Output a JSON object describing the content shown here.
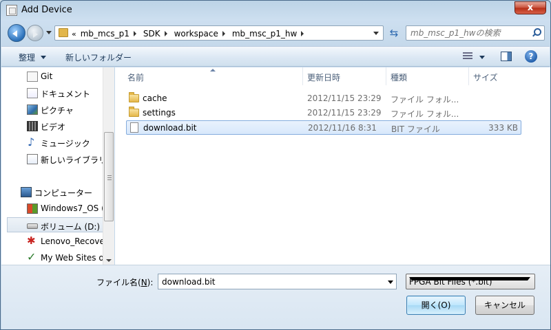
{
  "window": {
    "title": "Add Device",
    "close_label": "x"
  },
  "address": {
    "overflow": "«",
    "crumbs": [
      "mb_mcs_p1",
      "SDK",
      "workspace",
      "mb_msc_p1_hw"
    ]
  },
  "search": {
    "placeholder": "mb_msc_p1_hwの検索"
  },
  "toolbar": {
    "organize": "整理",
    "new_folder": "新しいフォルダー",
    "help": "?"
  },
  "nav": {
    "items": [
      {
        "label": "Git",
        "icon": "git-folder-icon"
      },
      {
        "label": "ドキュメント",
        "icon": "documents-icon"
      },
      {
        "label": "ピクチャ",
        "icon": "pictures-icon"
      },
      {
        "label": "ビデオ",
        "icon": "video-icon"
      },
      {
        "label": "ミュージック",
        "icon": "music-icon"
      },
      {
        "label": "新しいライブラリ",
        "icon": "library-icon"
      },
      {
        "label": "コンピューター",
        "icon": "computer-icon"
      },
      {
        "label": "Windows7_OS (",
        "icon": "windows-drive-icon"
      },
      {
        "label": "ボリューム (D:)",
        "icon": "drive-icon"
      },
      {
        "label": "Lenovo_Recove",
        "icon": "lenovo-recovery-icon"
      },
      {
        "label": "My Web Sites o",
        "icon": "web-sites-icon"
      }
    ]
  },
  "columns": {
    "name": "名前",
    "date": "更新日時",
    "type": "種類",
    "size": "サイズ"
  },
  "files": [
    {
      "name": "cache",
      "date": "2012/11/15 23:29",
      "type": "ファイル フォル...",
      "size": "",
      "kind": "folder"
    },
    {
      "name": "settings",
      "date": "2012/11/15 23:29",
      "type": "ファイル フォル...",
      "size": "",
      "kind": "folder"
    },
    {
      "name": "download.bit",
      "date": "2012/11/16 8:31",
      "type": "BIT ファイル",
      "size": "333 KB",
      "kind": "file"
    }
  ],
  "footer": {
    "filename_label": "ファイル名(",
    "filename_key": "N",
    "filename_label_end": "):",
    "filename_value": "download.bit",
    "filetype": "FPGA Bit Files (*.bit)",
    "open_label": "開く(O)",
    "cancel_label": "キャンセル"
  },
  "colors": {
    "accent": "#3c7fb1",
    "selection": "#d8e8fb"
  }
}
